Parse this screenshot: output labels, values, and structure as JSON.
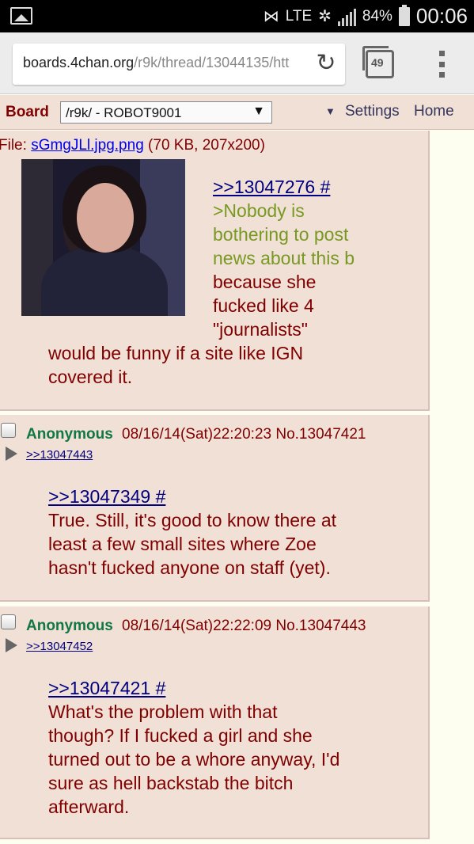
{
  "status_bar": {
    "network": "LTE",
    "battery_pct": "84%",
    "time": "00:06"
  },
  "browser": {
    "url_host": "boards.4chan.org",
    "url_path": "/r9k/thread/13044135/htt",
    "tab_count": "49"
  },
  "nav": {
    "board_label": "Board",
    "board_selected": "/r9k/ - ROBOT9001",
    "settings": "Settings",
    "home": "Home"
  },
  "posts": [
    {
      "file_prefix": "File: ",
      "file_name": "sGmgJLl.jpg.png",
      "file_info": " (70 KB, 207x200)",
      "quote": ">>13047276 #",
      "greentext": [
        ">Nobody is",
        "bothering to post",
        "news about this b"
      ],
      "text_side": [
        "because she",
        "fucked like 4",
        "\"journalists\""
      ],
      "text_full": [
        "would be funny if a site like IGN",
        "covered it."
      ]
    },
    {
      "name": "Anonymous",
      "datetime": "08/16/14(Sat)22:20:23 No.13047421",
      "backlink": ">>13047443",
      "quote": ">>13047349 #",
      "text": [
        "True. Still, it's good to know there at",
        "least a few small sites where Zoe",
        "hasn't fucked anyone on staff (yet)."
      ]
    },
    {
      "name": "Anonymous",
      "datetime": "08/16/14(Sat)22:22:09 No.13047443",
      "backlink": ">>13047452",
      "quote": ">>13047421 #",
      "text": [
        "What's the problem with that",
        "though? If I fucked a girl and she",
        "turned out to be a whore anyway, I'd",
        "sure as hell backstab the bitch",
        "afterward."
      ]
    }
  ]
}
